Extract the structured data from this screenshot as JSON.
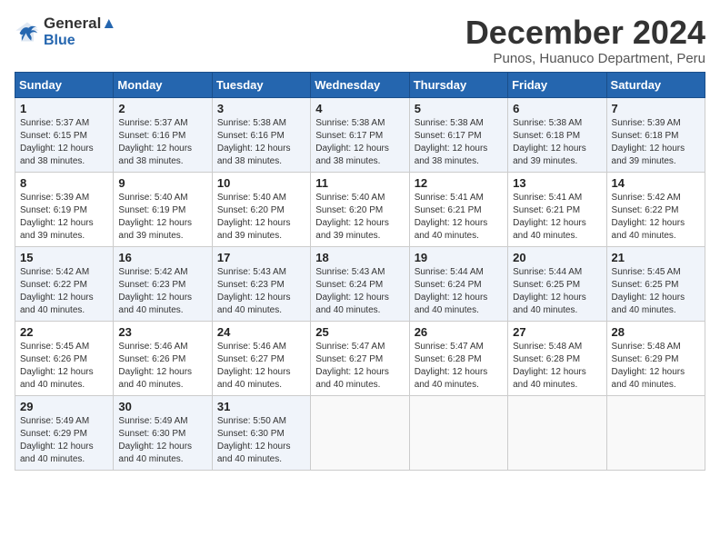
{
  "logo": {
    "line1": "General",
    "line2": "Blue"
  },
  "title": "December 2024",
  "subtitle": "Punos, Huanuco Department, Peru",
  "weekdays": [
    "Sunday",
    "Monday",
    "Tuesday",
    "Wednesday",
    "Thursday",
    "Friday",
    "Saturday"
  ],
  "weeks": [
    [
      {
        "day": "1",
        "info": "Sunrise: 5:37 AM\nSunset: 6:15 PM\nDaylight: 12 hours and 38 minutes."
      },
      {
        "day": "2",
        "info": "Sunrise: 5:37 AM\nSunset: 6:16 PM\nDaylight: 12 hours and 38 minutes."
      },
      {
        "day": "3",
        "info": "Sunrise: 5:38 AM\nSunset: 6:16 PM\nDaylight: 12 hours and 38 minutes."
      },
      {
        "day": "4",
        "info": "Sunrise: 5:38 AM\nSunset: 6:17 PM\nDaylight: 12 hours and 38 minutes."
      },
      {
        "day": "5",
        "info": "Sunrise: 5:38 AM\nSunset: 6:17 PM\nDaylight: 12 hours and 38 minutes."
      },
      {
        "day": "6",
        "info": "Sunrise: 5:38 AM\nSunset: 6:18 PM\nDaylight: 12 hours and 39 minutes."
      },
      {
        "day": "7",
        "info": "Sunrise: 5:39 AM\nSunset: 6:18 PM\nDaylight: 12 hours and 39 minutes."
      }
    ],
    [
      {
        "day": "8",
        "info": "Sunrise: 5:39 AM\nSunset: 6:19 PM\nDaylight: 12 hours and 39 minutes."
      },
      {
        "day": "9",
        "info": "Sunrise: 5:40 AM\nSunset: 6:19 PM\nDaylight: 12 hours and 39 minutes."
      },
      {
        "day": "10",
        "info": "Sunrise: 5:40 AM\nSunset: 6:20 PM\nDaylight: 12 hours and 39 minutes."
      },
      {
        "day": "11",
        "info": "Sunrise: 5:40 AM\nSunset: 6:20 PM\nDaylight: 12 hours and 39 minutes."
      },
      {
        "day": "12",
        "info": "Sunrise: 5:41 AM\nSunset: 6:21 PM\nDaylight: 12 hours and 40 minutes."
      },
      {
        "day": "13",
        "info": "Sunrise: 5:41 AM\nSunset: 6:21 PM\nDaylight: 12 hours and 40 minutes."
      },
      {
        "day": "14",
        "info": "Sunrise: 5:42 AM\nSunset: 6:22 PM\nDaylight: 12 hours and 40 minutes."
      }
    ],
    [
      {
        "day": "15",
        "info": "Sunrise: 5:42 AM\nSunset: 6:22 PM\nDaylight: 12 hours and 40 minutes."
      },
      {
        "day": "16",
        "info": "Sunrise: 5:42 AM\nSunset: 6:23 PM\nDaylight: 12 hours and 40 minutes."
      },
      {
        "day": "17",
        "info": "Sunrise: 5:43 AM\nSunset: 6:23 PM\nDaylight: 12 hours and 40 minutes."
      },
      {
        "day": "18",
        "info": "Sunrise: 5:43 AM\nSunset: 6:24 PM\nDaylight: 12 hours and 40 minutes."
      },
      {
        "day": "19",
        "info": "Sunrise: 5:44 AM\nSunset: 6:24 PM\nDaylight: 12 hours and 40 minutes."
      },
      {
        "day": "20",
        "info": "Sunrise: 5:44 AM\nSunset: 6:25 PM\nDaylight: 12 hours and 40 minutes."
      },
      {
        "day": "21",
        "info": "Sunrise: 5:45 AM\nSunset: 6:25 PM\nDaylight: 12 hours and 40 minutes."
      }
    ],
    [
      {
        "day": "22",
        "info": "Sunrise: 5:45 AM\nSunset: 6:26 PM\nDaylight: 12 hours and 40 minutes."
      },
      {
        "day": "23",
        "info": "Sunrise: 5:46 AM\nSunset: 6:26 PM\nDaylight: 12 hours and 40 minutes."
      },
      {
        "day": "24",
        "info": "Sunrise: 5:46 AM\nSunset: 6:27 PM\nDaylight: 12 hours and 40 minutes."
      },
      {
        "day": "25",
        "info": "Sunrise: 5:47 AM\nSunset: 6:27 PM\nDaylight: 12 hours and 40 minutes."
      },
      {
        "day": "26",
        "info": "Sunrise: 5:47 AM\nSunset: 6:28 PM\nDaylight: 12 hours and 40 minutes."
      },
      {
        "day": "27",
        "info": "Sunrise: 5:48 AM\nSunset: 6:28 PM\nDaylight: 12 hours and 40 minutes."
      },
      {
        "day": "28",
        "info": "Sunrise: 5:48 AM\nSunset: 6:29 PM\nDaylight: 12 hours and 40 minutes."
      }
    ],
    [
      {
        "day": "29",
        "info": "Sunrise: 5:49 AM\nSunset: 6:29 PM\nDaylight: 12 hours and 40 minutes."
      },
      {
        "day": "30",
        "info": "Sunrise: 5:49 AM\nSunset: 6:30 PM\nDaylight: 12 hours and 40 minutes."
      },
      {
        "day": "31",
        "info": "Sunrise: 5:50 AM\nSunset: 6:30 PM\nDaylight: 12 hours and 40 minutes."
      },
      {
        "day": "",
        "info": ""
      },
      {
        "day": "",
        "info": ""
      },
      {
        "day": "",
        "info": ""
      },
      {
        "day": "",
        "info": ""
      }
    ]
  ]
}
